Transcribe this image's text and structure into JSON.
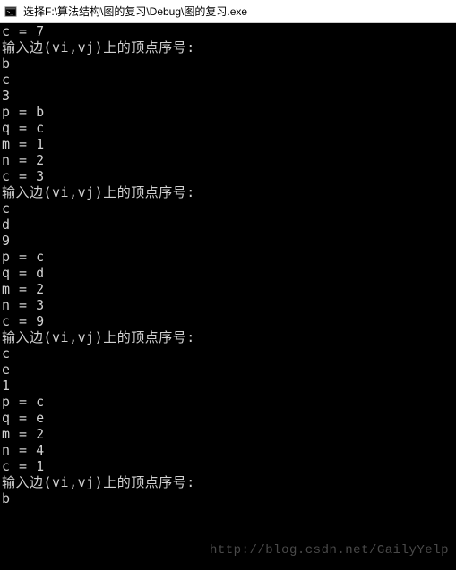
{
  "title": "选择F:\\算法结构\\图的复习\\Debug\\图的复习.exe",
  "icon_name": "console-app-icon",
  "console_lines": [
    "c = 7",
    "输入边(vi,vj)上的顶点序号:",
    "b",
    "c",
    "3",
    "p = b",
    "q = c",
    "m = 1",
    "n = 2",
    "c = 3",
    "输入边(vi,vj)上的顶点序号:",
    "c",
    "d",
    "9",
    "p = c",
    "q = d",
    "m = 2",
    "n = 3",
    "c = 9",
    "输入边(vi,vj)上的顶点序号:",
    "c",
    "e",
    "1",
    "p = c",
    "q = e",
    "m = 2",
    "n = 4",
    "c = 1",
    "输入边(vi,vj)上的顶点序号:",
    "b"
  ],
  "watermark": "http://blog.csdn.net/GailyYelp"
}
